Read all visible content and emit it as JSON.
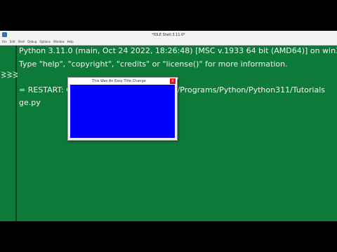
{
  "idle": {
    "title": "*IDLE Shell 3.11.0*",
    "menu": [
      "File",
      "Edit",
      "Shell",
      "Debug",
      "Options",
      "Window",
      "Help"
    ],
    "prompts": [
      ">>>",
      ">>>"
    ],
    "lines": [
      "Python 3.11.0 (main, Oct 24 2022, 18:26:48) [MSC v.1933 64 bit (AMD64)] on win32",
      "Type \"help\", \"copyright\", \"credits\" or \"license()\" for more information.",
      "= RESTART: C:/Users/User/AppData/Local/Programs/Python/Python311/Tutorials",
      "ge.py"
    ]
  },
  "tk_window": {
    "title": "This Was An Easy Title Change",
    "close_glyph": "x",
    "canvas_color": "#0000ff"
  },
  "colors": {
    "shell_background": "#0e7a3a",
    "letterbox": "#000000"
  }
}
